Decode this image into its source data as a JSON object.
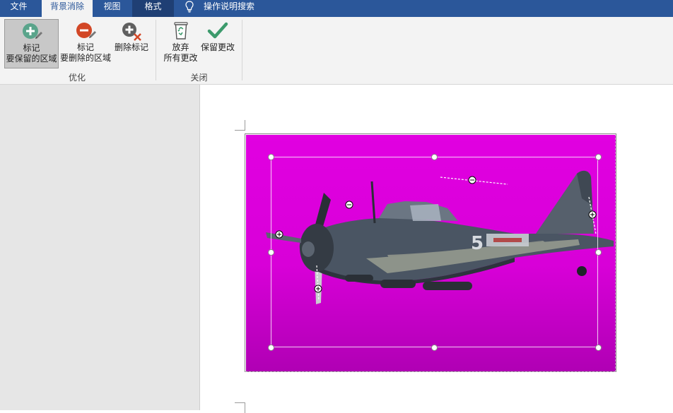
{
  "tabs": [
    {
      "label": "文件"
    },
    {
      "label": "背景消除"
    },
    {
      "label": "视图"
    },
    {
      "label": "格式"
    }
  ],
  "tell_me": "操作说明搜索",
  "ribbon": {
    "mark_keep": {
      "line1": "标记",
      "line2": "要保留的区域"
    },
    "mark_remove": {
      "line1": "标记",
      "line2": "要删除的区域"
    },
    "delete_mark": {
      "line1": "删除标记"
    },
    "discard": {
      "line1": "放弃",
      "line2": "所有更改"
    },
    "keep": {
      "line1": "保留更改"
    },
    "group_refine": "优化",
    "group_close": "关闭"
  },
  "colors": {
    "tabbar": "#2b579a",
    "ribbon": "#f3f3f3",
    "background_removal": "#e100e1",
    "keep_mark": "#5aa48b",
    "remove_mark": "#d24726",
    "accept_check": "#3c9a6c"
  },
  "icons": [
    "mark-keep-icon",
    "mark-remove-icon",
    "delete-mark-icon",
    "discard-bin-icon",
    "keep-check-icon",
    "lightbulb-icon"
  ]
}
